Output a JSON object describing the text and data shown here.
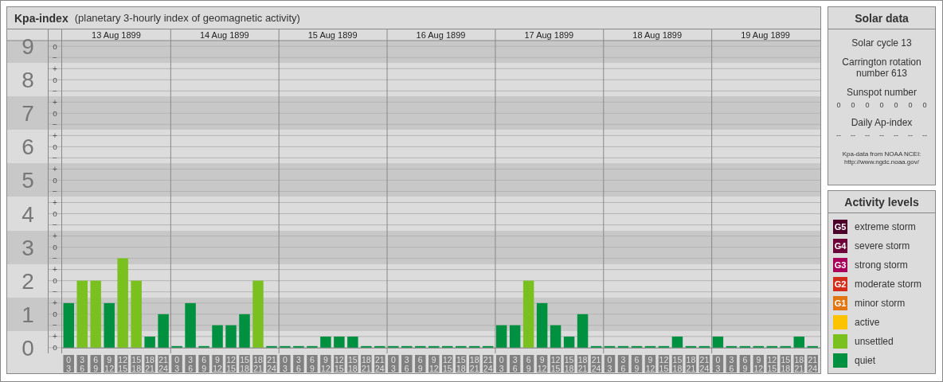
{
  "kpa_panel": {
    "title": "Kpa-index",
    "subtitle": "(planetary 3-hourly index of geomagnetic activity)",
    "days": [
      "13 Aug 1899",
      "14 Aug 1899",
      "15 Aug 1899",
      "16 Aug 1899",
      "17 Aug 1899",
      "18 Aug 1899",
      "19 Aug 1899"
    ],
    "scale_marks": [
      "o",
      "−",
      "+",
      "o",
      "−",
      "+",
      "o",
      "−",
      "+",
      "o",
      "−",
      "+",
      "o",
      "−",
      "+",
      "o",
      "−",
      "+",
      "o",
      "−",
      "+",
      "o",
      "−",
      "+",
      "o",
      "−",
      "+",
      "o"
    ],
    "chart_data": {
      "type": "bar",
      "grid": true,
      "categories": [
        "0 3",
        "3 6",
        "6 9",
        "9 12",
        "12 15",
        "15 18",
        "18 21",
        "21 24",
        "0 3",
        "3 6",
        "6 9",
        "9 12",
        "12 15",
        "15 18",
        "18 21",
        "21 24",
        "0 3",
        "3 6",
        "6 9",
        "9 12",
        "12 15",
        "15 18",
        "18 21",
        "21 24",
        "0 3",
        "3 6",
        "6 9",
        "9 12",
        "12 15",
        "15 18",
        "18 21",
        "21 24",
        "0 3",
        "3 6",
        "6 9",
        "9 12",
        "12 15",
        "15 18",
        "18 21",
        "21 24",
        "0 3",
        "3 6",
        "6 9",
        "9 12",
        "12 15",
        "15 18",
        "18 21",
        "21 24",
        "0 3",
        "3 6",
        "6 9",
        "9 12",
        "12 15",
        "15 18",
        "18 21",
        "21 24"
      ],
      "series": [
        {
          "name": "extreme storm",
          "color": "#4a0028",
          "values": [
            null,
            null,
            null,
            null,
            null,
            null,
            null,
            null,
            null,
            null,
            null,
            null,
            null,
            null,
            null,
            null,
            null,
            null,
            null,
            null,
            null,
            null,
            null,
            null,
            null,
            null,
            null,
            null,
            null,
            null,
            null,
            null,
            null,
            null,
            null,
            null,
            null,
            null,
            null,
            null,
            null,
            null,
            null,
            null,
            null,
            null,
            null,
            null,
            null,
            null,
            null,
            null,
            null,
            null,
            null,
            null
          ]
        },
        {
          "name": "severe storm",
          "color": "#6c0038",
          "values": [
            null,
            null,
            null,
            null,
            null,
            null,
            null,
            null,
            null,
            null,
            null,
            null,
            null,
            null,
            null,
            null,
            null,
            null,
            null,
            null,
            null,
            null,
            null,
            null,
            null,
            null,
            null,
            null,
            null,
            null,
            null,
            null,
            null,
            null,
            null,
            null,
            null,
            null,
            null,
            null,
            null,
            null,
            null,
            null,
            null,
            null,
            null,
            null,
            null,
            null,
            null,
            null,
            null,
            null,
            null,
            null
          ]
        },
        {
          "name": "strong storm",
          "color": "#a8005a",
          "values": [
            null,
            null,
            null,
            null,
            null,
            null,
            null,
            null,
            null,
            null,
            null,
            null,
            null,
            null,
            null,
            null,
            null,
            null,
            null,
            null,
            null,
            null,
            null,
            null,
            null,
            null,
            null,
            null,
            null,
            null,
            null,
            null,
            null,
            null,
            null,
            null,
            null,
            null,
            null,
            null,
            null,
            null,
            null,
            null,
            null,
            null,
            null,
            null,
            null,
            null,
            null,
            null,
            null,
            null,
            null,
            null
          ]
        },
        {
          "name": "moderate storm",
          "color": "#d42c1a",
          "values": [
            null,
            null,
            null,
            null,
            null,
            null,
            null,
            null,
            null,
            null,
            null,
            null,
            null,
            null,
            null,
            null,
            null,
            null,
            null,
            null,
            null,
            null,
            null,
            null,
            null,
            null,
            null,
            null,
            null,
            null,
            null,
            null,
            null,
            null,
            null,
            null,
            null,
            null,
            null,
            null,
            null,
            null,
            null,
            null,
            null,
            null,
            null,
            null,
            null,
            null,
            null,
            null,
            null,
            null,
            null,
            null
          ]
        },
        {
          "name": "minor storm",
          "color": "#e27612",
          "values": [
            null,
            null,
            null,
            null,
            null,
            null,
            null,
            null,
            null,
            null,
            null,
            null,
            null,
            null,
            null,
            null,
            null,
            null,
            null,
            null,
            null,
            null,
            null,
            null,
            null,
            null,
            null,
            null,
            null,
            null,
            null,
            null,
            null,
            null,
            null,
            null,
            null,
            null,
            null,
            null,
            null,
            null,
            null,
            null,
            null,
            null,
            null,
            null,
            null,
            null,
            null,
            null,
            null,
            null,
            null,
            null
          ]
        },
        {
          "name": "active",
          "color": "#fbc300",
          "values": [
            null,
            null,
            null,
            null,
            null,
            null,
            null,
            null,
            null,
            null,
            null,
            null,
            null,
            null,
            null,
            null,
            null,
            null,
            null,
            null,
            null,
            null,
            null,
            null,
            null,
            null,
            null,
            null,
            null,
            null,
            null,
            null,
            null,
            null,
            null,
            null,
            null,
            null,
            null,
            null,
            null,
            null,
            null,
            null,
            null,
            null,
            null,
            null,
            null,
            null,
            null,
            null,
            null,
            null,
            null,
            null
          ]
        },
        {
          "name": "unsettled",
          "color": "#7ac11f",
          "values": [
            null,
            2,
            2,
            null,
            2.67,
            2,
            null,
            null,
            null,
            null,
            null,
            null,
            null,
            null,
            2,
            null,
            null,
            null,
            null,
            null,
            null,
            null,
            null,
            null,
            null,
            null,
            null,
            null,
            null,
            null,
            null,
            null,
            null,
            null,
            2,
            null,
            null,
            null,
            null,
            null,
            null,
            null,
            null,
            null,
            null,
            null,
            null,
            null,
            null,
            null,
            null,
            null,
            null,
            null,
            null,
            null
          ]
        },
        {
          "name": "quiet",
          "color": "#009140",
          "values": [
            1.33,
            null,
            null,
            1.33,
            null,
            null,
            0.33,
            1,
            0,
            1.33,
            0,
            0.67,
            0.67,
            1,
            null,
            0,
            0,
            0,
            0,
            0.33,
            0.33,
            0.33,
            0,
            0,
            0,
            0,
            0,
            0,
            0,
            0,
            0,
            0,
            0.67,
            0.67,
            null,
            1.33,
            0.67,
            0.33,
            1,
            0,
            0,
            0,
            0,
            0,
            0,
            0.33,
            0,
            0,
            0.33,
            0,
            0,
            0,
            0,
            0,
            0.33,
            0
          ]
        }
      ],
      "ylim": [
        -0.17,
        9.17
      ],
      "yticks": [
        {
          "value": 0,
          "label": "0"
        },
        {
          "value": 1,
          "label": "1"
        },
        {
          "value": 2,
          "label": "2"
        },
        {
          "value": 3,
          "label": "3"
        },
        {
          "value": 4,
          "label": "4"
        },
        {
          "value": 5,
          "label": "5"
        },
        {
          "value": 6,
          "label": "6"
        },
        {
          "value": 7,
          "label": "7"
        },
        {
          "value": 8,
          "label": "8"
        },
        {
          "value": 9,
          "label": "9"
        }
      ]
    }
  },
  "solar_data": {
    "title": "Solar data",
    "cycle": "Solar cycle 13",
    "rotation": "Carrington rotation number 613",
    "sunspot_label": "Sunspot number",
    "sunspot_values": [
      "0",
      "0",
      "0",
      "0",
      "0",
      "0",
      "0"
    ],
    "ap_label": "Daily Ap-index",
    "ap_values": [
      "--",
      "--",
      "--",
      "--",
      "--",
      "--",
      "--"
    ],
    "source": "Kpa-data from NOAA NCEI:",
    "source_url": "http://www.ngdc.noaa.gov/"
  },
  "activity_levels": {
    "title": "Activity levels",
    "badges": [
      "G5",
      "G4",
      "G3",
      "G2",
      "G1"
    ]
  }
}
